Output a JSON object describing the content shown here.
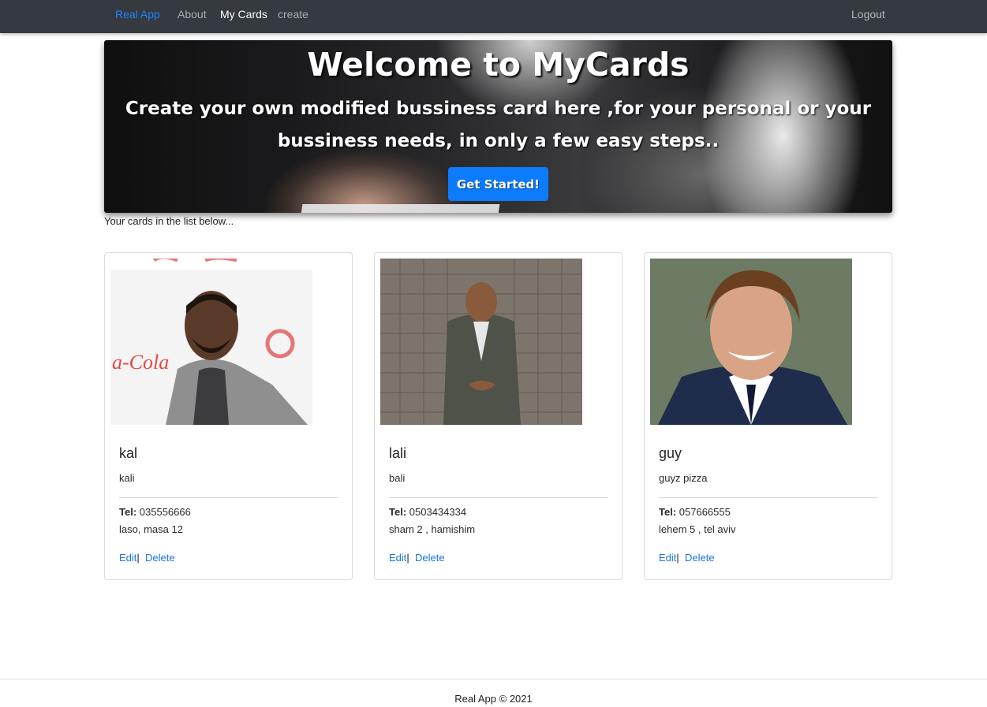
{
  "nav": {
    "brand": "Real App",
    "about": "About",
    "my_cards": "My Cards",
    "create": "create",
    "logout": "Logout"
  },
  "hero": {
    "title": "Welcome to MyCards",
    "subtitle": "Create your own modified bussiness card here ,for your personal or your bussiness needs, in only a few easy steps..",
    "button": "Get Started!"
  },
  "list_caption": "Your cards in the list below...",
  "cards": [
    {
      "name": "kal",
      "description": "kali",
      "tel_label": "Tel:",
      "tel": "035556666",
      "address": "laso, masa 12",
      "edit": "Edit",
      "separator": "|",
      "delete": "Delete"
    },
    {
      "name": "lali",
      "description": "bali",
      "tel_label": "Tel:",
      "tel": "0503434334",
      "address": "sham 2 , hamishim",
      "edit": "Edit",
      "separator": "|",
      "delete": "Delete"
    },
    {
      "name": "guy",
      "description": "guyz pizza",
      "tel_label": "Tel:",
      "tel": "057666555",
      "address": "lehem 5 , tel aviv",
      "edit": "Edit",
      "separator": "|",
      "delete": "Delete"
    }
  ],
  "footer": "Real App © 2021",
  "colors": {
    "navbar": "#343a40",
    "brand": "#1f83ff",
    "primary_button": "#0d7bfe",
    "link": "#1a73e8"
  }
}
